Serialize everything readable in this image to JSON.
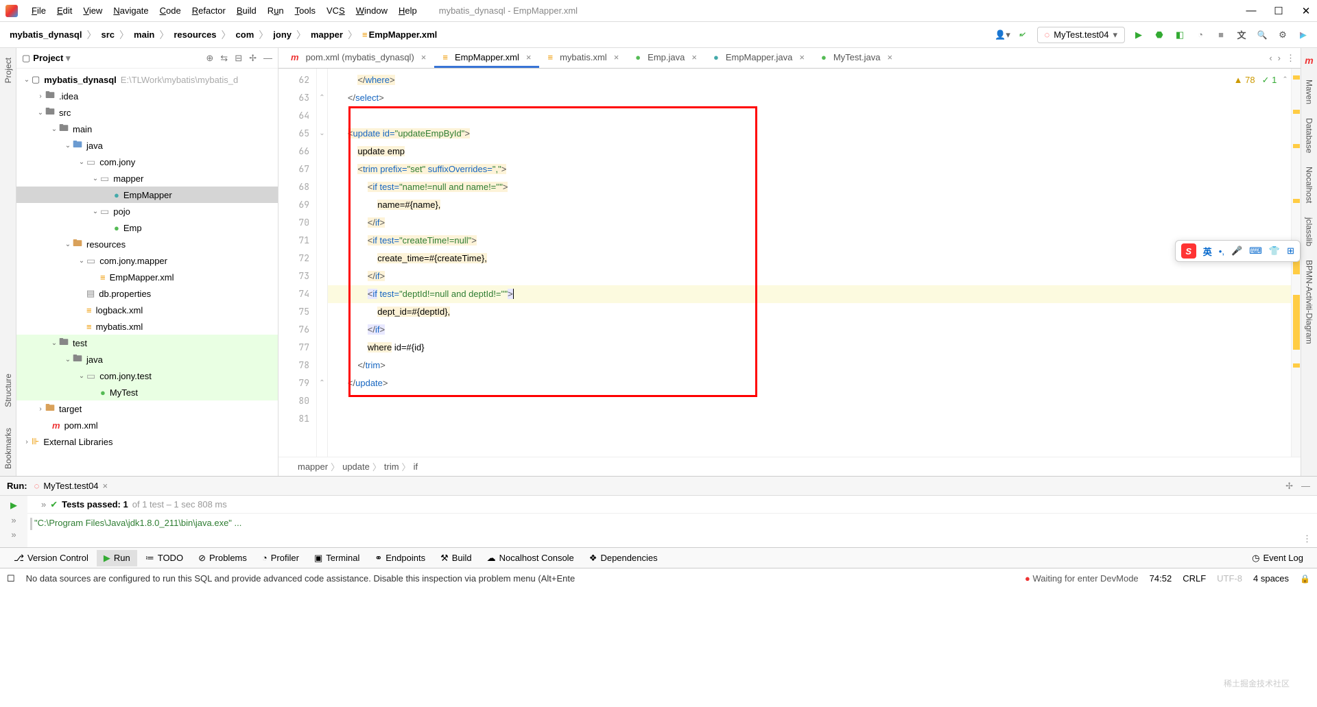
{
  "window": {
    "title": "mybatis_dynasql - EmpMapper.xml"
  },
  "menu": {
    "file": "File",
    "edit": "Edit",
    "view": "View",
    "navigate": "Navigate",
    "code": "Code",
    "refactor": "Refactor",
    "build": "Build",
    "run": "Run",
    "tools": "Tools",
    "vcs": "VCS",
    "window": "Window",
    "help": "Help"
  },
  "breadcrumb": [
    "mybatis_dynasql",
    "src",
    "main",
    "resources",
    "com",
    "jony",
    "mapper",
    "EmpMapper.xml"
  ],
  "runConfig": "MyTest.test04",
  "projectPanel": {
    "title": "Project"
  },
  "tree": {
    "root": "mybatis_dynasql",
    "rootPath": "E:\\TLWork\\mybatis\\mybatis_d",
    "idea": ".idea",
    "src": "src",
    "main": "main",
    "java": "java",
    "comjony": "com.jony",
    "mapper": "mapper",
    "empMapperIf": "EmpMapper",
    "pojo": "pojo",
    "emp": "Emp",
    "resources": "resources",
    "comjonymapper": "com.jony.mapper",
    "empMapperXml": "EmpMapper.xml",
    "dbProps": "db.properties",
    "logback": "logback.xml",
    "mybatisXml": "mybatis.xml",
    "test": "test",
    "testJava": "java",
    "comjonytest": "com.jony.test",
    "myTest": "MyTest",
    "target": "target",
    "pom": "pom.xml",
    "extLib": "External Libraries"
  },
  "tabs": [
    {
      "label": "pom.xml (mybatis_dynasql)",
      "icon": "m"
    },
    {
      "label": "EmpMapper.xml",
      "icon": "xml",
      "active": true
    },
    {
      "label": "mybatis.xml",
      "icon": "xml"
    },
    {
      "label": "Emp.java",
      "icon": "c"
    },
    {
      "label": "EmpMapper.java",
      "icon": "i"
    },
    {
      "label": "MyTest.java",
      "icon": "c"
    }
  ],
  "editor": {
    "warn": "78",
    "ok": "1",
    "lines": [
      62,
      63,
      64,
      65,
      66,
      67,
      68,
      69,
      70,
      71,
      72,
      73,
      74,
      75,
      76,
      77,
      78,
      79,
      80,
      81
    ],
    "crumbs": [
      "mapper",
      "update",
      "trim",
      "if"
    ],
    "code": {
      "l62": "</where>",
      "l63": "</select>",
      "l65_open": "<update",
      "l65_idAttr": " id=",
      "l65_idVal": "\"updateEmpById\"",
      "l65_close": ">",
      "l66": "update emp",
      "l67_open": "<trim",
      "l67_prefAttr": " prefix=",
      "l67_prefVal": "\"set\"",
      "l67_sufAttr": " suffixOverrides=",
      "l67_sufVal": "\",\"",
      "l67_close": ">",
      "l68_open": "<if",
      "l68_attr": " test=",
      "l68_val": "\"name!=null and name!=''\"",
      "l68_close": ">",
      "l69": "name=#{name},",
      "l70": "</if>",
      "l71_open": "<if",
      "l71_attr": " test=",
      "l71_val": "\"createTime!=null\"",
      "l71_close": ">",
      "l72": "create_time=#{createTime},",
      "l73": "</if>",
      "l74_open": "<if",
      "l74_attr": " test=",
      "l74_val": "\"deptId!=null and deptId!=''\"",
      "l74_close": ">",
      "l75": "dept_id=#{deptId},",
      "l76": "</if>",
      "l77": "where id=#{id}",
      "l78": "</trim>",
      "l79": "</update>"
    }
  },
  "runTool": {
    "title": "Run:",
    "tabLabel": "MyTest.test04",
    "testsPassed": "Tests passed: 1",
    "testsTotal": " of 1 test – 1 sec 808 ms",
    "consoleLine": "\"C:\\Program Files\\Java\\jdk1.8.0_211\\bin\\java.exe\" ..."
  },
  "bottomTools": {
    "vcs": "Version Control",
    "run": "Run",
    "todo": "TODO",
    "problems": "Problems",
    "profiler": "Profiler",
    "terminal": "Terminal",
    "endpoints": "Endpoints",
    "build": "Build",
    "nocalhost": "Nocalhost Console",
    "deps": "Dependencies",
    "eventLog": "Event Log"
  },
  "statusbar": {
    "msg": "No data sources are configured to run this SQL and provide advanced code assistance. Disable this inspection via problem menu (Alt+Ente",
    "waiting": "Waiting for enter DevMode",
    "pos": "74:52",
    "crlf": "CRLF",
    "enc": "UTF-8",
    "indent": "4 spaces"
  },
  "rightTools": {
    "maven": "Maven",
    "database": "Database",
    "nocalhost": "Nocalhost",
    "jclass": "jclasslib",
    "bpmn": "BPMN-Activiti-Diagram"
  },
  "leftTools": {
    "project": "Project",
    "structure": "Structure",
    "bookmarks": "Bookmarks"
  },
  "ime": {
    "lang": "英"
  },
  "watermark": "稀土掘金技术社区"
}
